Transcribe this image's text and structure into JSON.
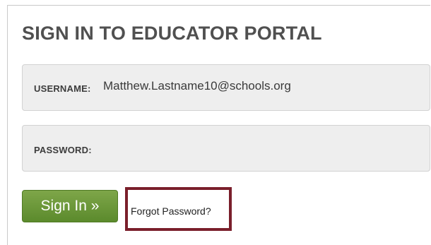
{
  "header": {
    "title": "SIGN IN TO EDUCATOR PORTAL"
  },
  "form": {
    "username": {
      "label": "USERNAME:",
      "value": "Matthew.Lastname10@schools.org"
    },
    "password": {
      "label": "PASSWORD:",
      "value": ""
    },
    "signin_label": "Sign In »",
    "forgot_label": "Forgot Password?"
  },
  "colors": {
    "button_green": "#6a9639",
    "highlight_border": "#7a1f2b",
    "field_background": "#eeeeee",
    "title_text": "#505050"
  }
}
